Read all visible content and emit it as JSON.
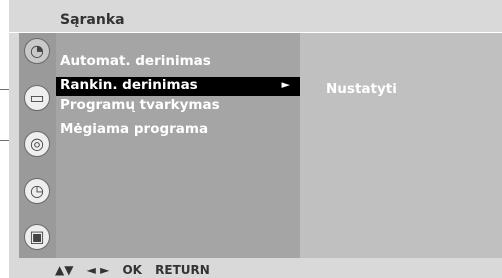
{
  "menu": {
    "title": "Sąranka",
    "items": [
      {
        "label": "Automat. derinimas",
        "selected": false
      },
      {
        "label": "Rankin. derinimas",
        "selected": true
      },
      {
        "label": "Programų tvarkymas",
        "selected": false
      },
      {
        "label": "Mėgiama programa",
        "selected": false
      }
    ],
    "submenu_item": "Nustatyti",
    "selected_arrow": "►"
  },
  "category_icons": [
    "setup-satellite-dish-icon",
    "picture-tv-icon",
    "audio-speaker-icon",
    "time-clock-icon",
    "option-toolbox-icon"
  ],
  "footer": {
    "updown": "▲▼",
    "leftright": "◄ ►",
    "ok": "OK",
    "return": "RETURN"
  },
  "colors": {
    "panel": "#d9d9d9",
    "icon_column": "#9a9a9a",
    "menu_column": "#a5a5a5",
    "submenu_column": "#c0c0c0",
    "highlight": "#000000",
    "text": "#ffffff"
  }
}
